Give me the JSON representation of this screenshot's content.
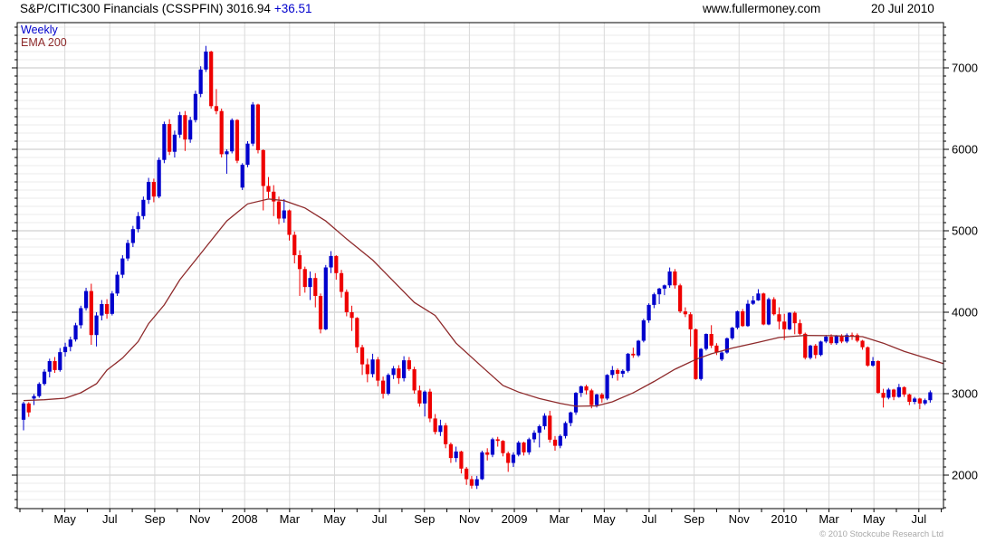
{
  "header": {
    "title": "S&P/CITIC300 Financials (CSSPFIN) 3016.94",
    "change": "+36.51",
    "site": "www.fullermoney.com",
    "date": "20 Jul 2010"
  },
  "legend": {
    "timeframe": "Weekly",
    "indicator": "EMA 200"
  },
  "footer": {
    "copyright": "© 2010 Stockcube Research Ltd"
  },
  "colors": {
    "up": "#0000cc",
    "down": "#ee0000",
    "ema": "#8e2a2b",
    "change_text": "#0000cc",
    "grid_minor": "#ebebeb",
    "grid_major": "#c4c4c4",
    "grid_vertical": "#d9d9d9",
    "axis": "#000000",
    "label_text": "#000000",
    "copyright_text": "#a8a8a8"
  },
  "chart_data": {
    "type": "candlestick",
    "title": "S&P/CITIC300 Financials (CSSPFIN)",
    "timeframe": "weekly",
    "last_close": 3016.94,
    "change": 36.51,
    "overlay": "EMA 200",
    "y_axis": {
      "min": 1589,
      "max": 7556,
      "ticks": [
        2000,
        3000,
        4000,
        5000,
        6000,
        7000
      ],
      "minor_step": 100
    },
    "x_axis": {
      "minor_tick_every_months": 1,
      "labels": [
        {
          "label": "May",
          "m": 2
        },
        {
          "label": "Jul",
          "m": 4
        },
        {
          "label": "Sep",
          "m": 6
        },
        {
          "label": "Nov",
          "m": 8
        },
        {
          "label": "2008",
          "m": 10
        },
        {
          "label": "Mar",
          "m": 12
        },
        {
          "label": "May",
          "m": 14
        },
        {
          "label": "Jul",
          "m": 16
        },
        {
          "label": "Sep",
          "m": 18
        },
        {
          "label": "Nov",
          "m": 20
        },
        {
          "label": "2009",
          "m": 22
        },
        {
          "label": "Mar",
          "m": 24
        },
        {
          "label": "May",
          "m": 26
        },
        {
          "label": "Jul",
          "m": 28
        },
        {
          "label": "Sep",
          "m": 30
        },
        {
          "label": "Nov",
          "m": 32
        },
        {
          "label": "2010",
          "m": 34
        },
        {
          "label": "Mar",
          "m": 36
        },
        {
          "label": "May",
          "m": 38
        },
        {
          "label": "Jul",
          "m": 40
        }
      ]
    },
    "candles": [
      [
        2680,
        2900,
        2550,
        2880
      ],
      [
        2880,
        2895,
        2715,
        2770
      ],
      [
        2940,
        2995,
        2860,
        2970
      ],
      [
        2970,
        3140,
        2950,
        3120
      ],
      [
        3120,
        3300,
        3100,
        3270
      ],
      [
        3270,
        3430,
        3200,
        3400
      ],
      [
        3400,
        3450,
        3255,
        3290
      ],
      [
        3290,
        3560,
        3270,
        3510
      ],
      [
        3510,
        3625,
        3455,
        3575
      ],
      [
        3575,
        3700,
        3520,
        3665
      ],
      [
        3665,
        3870,
        3640,
        3840
      ],
      [
        3840,
        4080,
        3800,
        4050
      ],
      [
        4050,
        4300,
        4020,
        4260
      ],
      [
        4260,
        4350,
        3600,
        3720
      ],
      [
        3720,
        4000,
        3580,
        3960
      ],
      [
        3960,
        4150,
        3900,
        4100
      ],
      [
        4100,
        4160,
        3920,
        3980
      ],
      [
        3980,
        4260,
        3960,
        4230
      ],
      [
        4230,
        4500,
        4200,
        4460
      ],
      [
        4460,
        4700,
        4420,
        4660
      ],
      [
        4660,
        4890,
        4630,
        4850
      ],
      [
        4850,
        5060,
        4800,
        5020
      ],
      [
        5020,
        5230,
        4980,
        5180
      ],
      [
        5180,
        5420,
        5140,
        5380
      ],
      [
        5380,
        5650,
        5330,
        5600
      ],
      [
        5600,
        5640,
        5350,
        5420
      ],
      [
        5420,
        5900,
        5400,
        5870
      ],
      [
        5870,
        6340,
        5830,
        6310
      ],
      [
        6310,
        6370,
        5930,
        5970
      ],
      [
        5970,
        6230,
        5900,
        6180
      ],
      [
        6180,
        6460,
        6140,
        6420
      ],
      [
        6420,
        6470,
        5980,
        6120
      ],
      [
        6120,
        6400,
        6080,
        6360
      ],
      [
        6360,
        6720,
        6330,
        6680
      ],
      [
        6680,
        7020,
        6640,
        6980
      ],
      [
        6980,
        7270,
        6950,
        7200
      ],
      [
        7200,
        7210,
        6500,
        6530
      ],
      [
        6530,
        6740,
        6430,
        6470
      ],
      [
        6470,
        6500,
        5900,
        5940
      ],
      [
        5940,
        6000,
        5700,
        5975
      ],
      [
        5975,
        6380,
        5950,
        6360
      ],
      [
        6360,
        6370,
        5830,
        5860
      ],
      [
        5530,
        5830,
        5500,
        5810
      ],
      [
        5810,
        6100,
        5780,
        6070
      ],
      [
        6070,
        6580,
        6040,
        6550
      ],
      [
        6550,
        6560,
        5950,
        5990
      ],
      [
        5990,
        6000,
        5250,
        5550
      ],
      [
        5550,
        5660,
        5400,
        5480
      ],
      [
        5480,
        5560,
        5180,
        5360
      ],
      [
        5360,
        5420,
        5080,
        5150
      ],
      [
        5150,
        5390,
        5100,
        5250
      ],
      [
        5250,
        5260,
        4880,
        4950
      ],
      [
        4950,
        4990,
        4600,
        4700
      ],
      [
        4700,
        4760,
        4200,
        4530
      ],
      [
        4530,
        4560,
        4240,
        4310
      ],
      [
        4310,
        4500,
        4150,
        4420
      ],
      [
        4420,
        4480,
        4060,
        4200
      ],
      [
        4200,
        4230,
        3740,
        3790
      ],
      [
        3790,
        4580,
        3780,
        4550
      ],
      [
        4550,
        4750,
        4480,
        4690
      ],
      [
        4690,
        4700,
        4400,
        4480
      ],
      [
        4480,
        4520,
        4180,
        4250
      ],
      [
        4250,
        4280,
        3950,
        4000
      ],
      [
        4000,
        4080,
        3770,
        3930
      ],
      [
        3930,
        3940,
        3500,
        3570
      ],
      [
        3570,
        3600,
        3230,
        3360
      ],
      [
        3360,
        3430,
        3140,
        3240
      ],
      [
        3240,
        3490,
        3200,
        3420
      ],
      [
        3420,
        3450,
        3090,
        3160
      ],
      [
        3160,
        3210,
        2940,
        3000
      ],
      [
        3000,
        3250,
        2980,
        3230
      ],
      [
        3230,
        3340,
        3180,
        3310
      ],
      [
        3310,
        3350,
        3120,
        3190
      ],
      [
        3190,
        3460,
        3150,
        3410
      ],
      [
        3410,
        3450,
        3280,
        3300
      ],
      [
        3300,
        3330,
        3000,
        3040
      ],
      [
        3040,
        3100,
        2840,
        2880
      ],
      [
        2880,
        3040,
        2720,
        3025
      ],
      [
        3025,
        3060,
        2650,
        2695
      ],
      [
        2695,
        2750,
        2500,
        2530
      ],
      [
        2530,
        2680,
        2480,
        2610
      ],
      [
        2610,
        2640,
        2330,
        2380
      ],
      [
        2380,
        2400,
        2150,
        2210
      ],
      [
        2210,
        2350,
        2160,
        2290
      ],
      [
        2290,
        2300,
        2020,
        2080
      ],
      [
        2080,
        2100,
        1880,
        1950
      ],
      [
        1950,
        1990,
        1835,
        1870
      ],
      [
        1870,
        1990,
        1830,
        1950
      ],
      [
        1950,
        2300,
        1940,
        2280
      ],
      [
        2280,
        2330,
        2180,
        2250
      ],
      [
        2250,
        2460,
        2220,
        2440
      ],
      [
        2440,
        2470,
        2350,
        2420
      ],
      [
        2420,
        2430,
        2230,
        2270
      ],
      [
        2270,
        2290,
        2040,
        2150
      ],
      [
        2150,
        2280,
        2100,
        2250
      ],
      [
        2250,
        2420,
        2230,
        2400
      ],
      [
        2400,
        2410,
        2240,
        2280
      ],
      [
        2280,
        2460,
        2250,
        2440
      ],
      [
        2440,
        2550,
        2400,
        2520
      ],
      [
        2520,
        2620,
        2340,
        2600
      ],
      [
        2600,
        2760,
        2560,
        2730
      ],
      [
        2730,
        2790,
        2400,
        2435
      ],
      [
        2435,
        2480,
        2300,
        2360
      ],
      [
        2360,
        2500,
        2330,
        2480
      ],
      [
        2480,
        2660,
        2450,
        2640
      ],
      [
        2640,
        2780,
        2600,
        2770
      ],
      [
        2770,
        3020,
        2740,
        3010
      ],
      [
        3010,
        3100,
        2960,
        3090
      ],
      [
        3090,
        3110,
        2990,
        3040
      ],
      [
        3040,
        3060,
        2820,
        2860
      ],
      [
        2860,
        3000,
        2830,
        2990
      ],
      [
        2990,
        3010,
        2890,
        2940
      ],
      [
        2940,
        3240,
        2920,
        3230
      ],
      [
        3230,
        3340,
        3190,
        3290
      ],
      [
        3290,
        3310,
        3160,
        3245
      ],
      [
        3245,
        3300,
        3200,
        3280
      ],
      [
        3280,
        3500,
        3260,
        3490
      ],
      [
        3490,
        3565,
        3440,
        3470
      ],
      [
        3470,
        3660,
        3450,
        3650
      ],
      [
        3650,
        3920,
        3630,
        3900
      ],
      [
        3900,
        4110,
        3870,
        4090
      ],
      [
        4090,
        4240,
        4050,
        4220
      ],
      [
        4220,
        4300,
        4100,
        4290
      ],
      [
        4290,
        4340,
        4210,
        4330
      ],
      [
        4330,
        4549,
        4300,
        4500
      ],
      [
        4500,
        4530,
        4290,
        4330
      ],
      [
        4330,
        4350,
        3990,
        4010
      ],
      [
        4010,
        4060,
        3940,
        3975
      ],
      [
        3975,
        4000,
        3580,
        3790
      ],
      [
        3790,
        3800,
        3170,
        3180
      ],
      [
        3180,
        3560,
        3160,
        3550
      ],
      [
        3550,
        3740,
        3530,
        3733
      ],
      [
        3733,
        3841,
        3560,
        3590
      ],
      [
        3590,
        3620,
        3474,
        3510
      ],
      [
        3420,
        3520,
        3400,
        3505
      ],
      [
        3505,
        3690,
        3490,
        3680
      ],
      [
        3680,
        3820,
        3660,
        3810
      ],
      [
        3810,
        4020,
        3790,
        4011
      ],
      [
        4011,
        4040,
        3820,
        3830
      ],
      [
        3830,
        4150,
        3820,
        4104
      ],
      [
        4104,
        4200,
        4090,
        4145
      ],
      [
        4145,
        4283,
        4140,
        4230
      ],
      [
        4230,
        4240,
        3840,
        3850
      ],
      [
        3850,
        4180,
        3840,
        4160
      ],
      [
        4160,
        4185,
        3960,
        3975
      ],
      [
        3975,
        4060,
        3790,
        3885
      ],
      [
        3885,
        3980,
        3660,
        3790
      ],
      [
        3790,
        4000,
        3780,
        3993
      ],
      [
        3993,
        4010,
        3730,
        3865
      ],
      [
        3865,
        3910,
        3720,
        3735
      ],
      [
        3735,
        3750,
        3420,
        3440
      ],
      [
        3440,
        3600,
        3420,
        3590
      ],
      [
        3590,
        3610,
        3430,
        3475
      ],
      [
        3475,
        3650,
        3460,
        3640
      ],
      [
        3640,
        3720,
        3620,
        3700
      ],
      [
        3700,
        3730,
        3600,
        3620
      ],
      [
        3620,
        3720,
        3600,
        3710
      ],
      [
        3710,
        3730,
        3620,
        3640
      ],
      [
        3640,
        3740,
        3620,
        3720
      ],
      [
        3720,
        3750,
        3660,
        3719
      ],
      [
        3719,
        3740,
        3630,
        3650
      ],
      [
        3650,
        3660,
        3540,
        3570
      ],
      [
        3570,
        3580,
        3330,
        3345
      ],
      [
        3345,
        3450,
        3330,
        3400
      ],
      [
        3400,
        3410,
        3000,
        3010
      ],
      [
        3010,
        3060,
        2830,
        2950
      ],
      [
        2950,
        3070,
        2930,
        3050
      ],
      [
        3050,
        3060,
        2920,
        2960
      ],
      [
        2960,
        3120,
        2950,
        3080
      ],
      [
        3080,
        3090,
        2960,
        2990
      ],
      [
        2990,
        3000,
        2860,
        2900
      ],
      [
        2900,
        2960,
        2870,
        2940
      ],
      [
        2940,
        2950,
        2810,
        2880
      ],
      [
        2880,
        2940,
        2860,
        2920
      ],
      [
        2920,
        3040,
        2890,
        3017
      ]
    ],
    "ema200": [
      [
        0,
        2915
      ],
      [
        4,
        2926
      ],
      [
        8,
        2944
      ],
      [
        11,
        3011
      ],
      [
        14,
        3122
      ],
      [
        16,
        3289
      ],
      [
        19,
        3437
      ],
      [
        22,
        3640
      ],
      [
        24,
        3860
      ],
      [
        27,
        4090
      ],
      [
        30,
        4400
      ],
      [
        35,
        4800
      ],
      [
        39,
        5120
      ],
      [
        43,
        5330
      ],
      [
        47,
        5390
      ],
      [
        50,
        5370
      ],
      [
        54,
        5280
      ],
      [
        58,
        5120
      ],
      [
        62,
        4900
      ],
      [
        67,
        4640
      ],
      [
        71,
        4380
      ],
      [
        75,
        4120
      ],
      [
        79,
        3960
      ],
      [
        83,
        3620
      ],
      [
        88,
        3330
      ],
      [
        92,
        3100
      ],
      [
        95,
        3020
      ],
      [
        99,
        2940
      ],
      [
        103,
        2880
      ],
      [
        106,
        2845
      ],
      [
        110,
        2850
      ],
      [
        113,
        2900
      ],
      [
        117,
        3010
      ],
      [
        121,
        3150
      ],
      [
        125,
        3300
      ],
      [
        129,
        3420
      ],
      [
        132,
        3490
      ],
      [
        136,
        3560
      ],
      [
        141,
        3630
      ],
      [
        145,
        3690
      ],
      [
        150,
        3715
      ],
      [
        155,
        3712
      ],
      [
        161,
        3700
      ],
      [
        165,
        3620
      ],
      [
        169,
        3520
      ],
      [
        173,
        3440
      ],
      [
        176.5,
        3370
      ]
    ]
  }
}
